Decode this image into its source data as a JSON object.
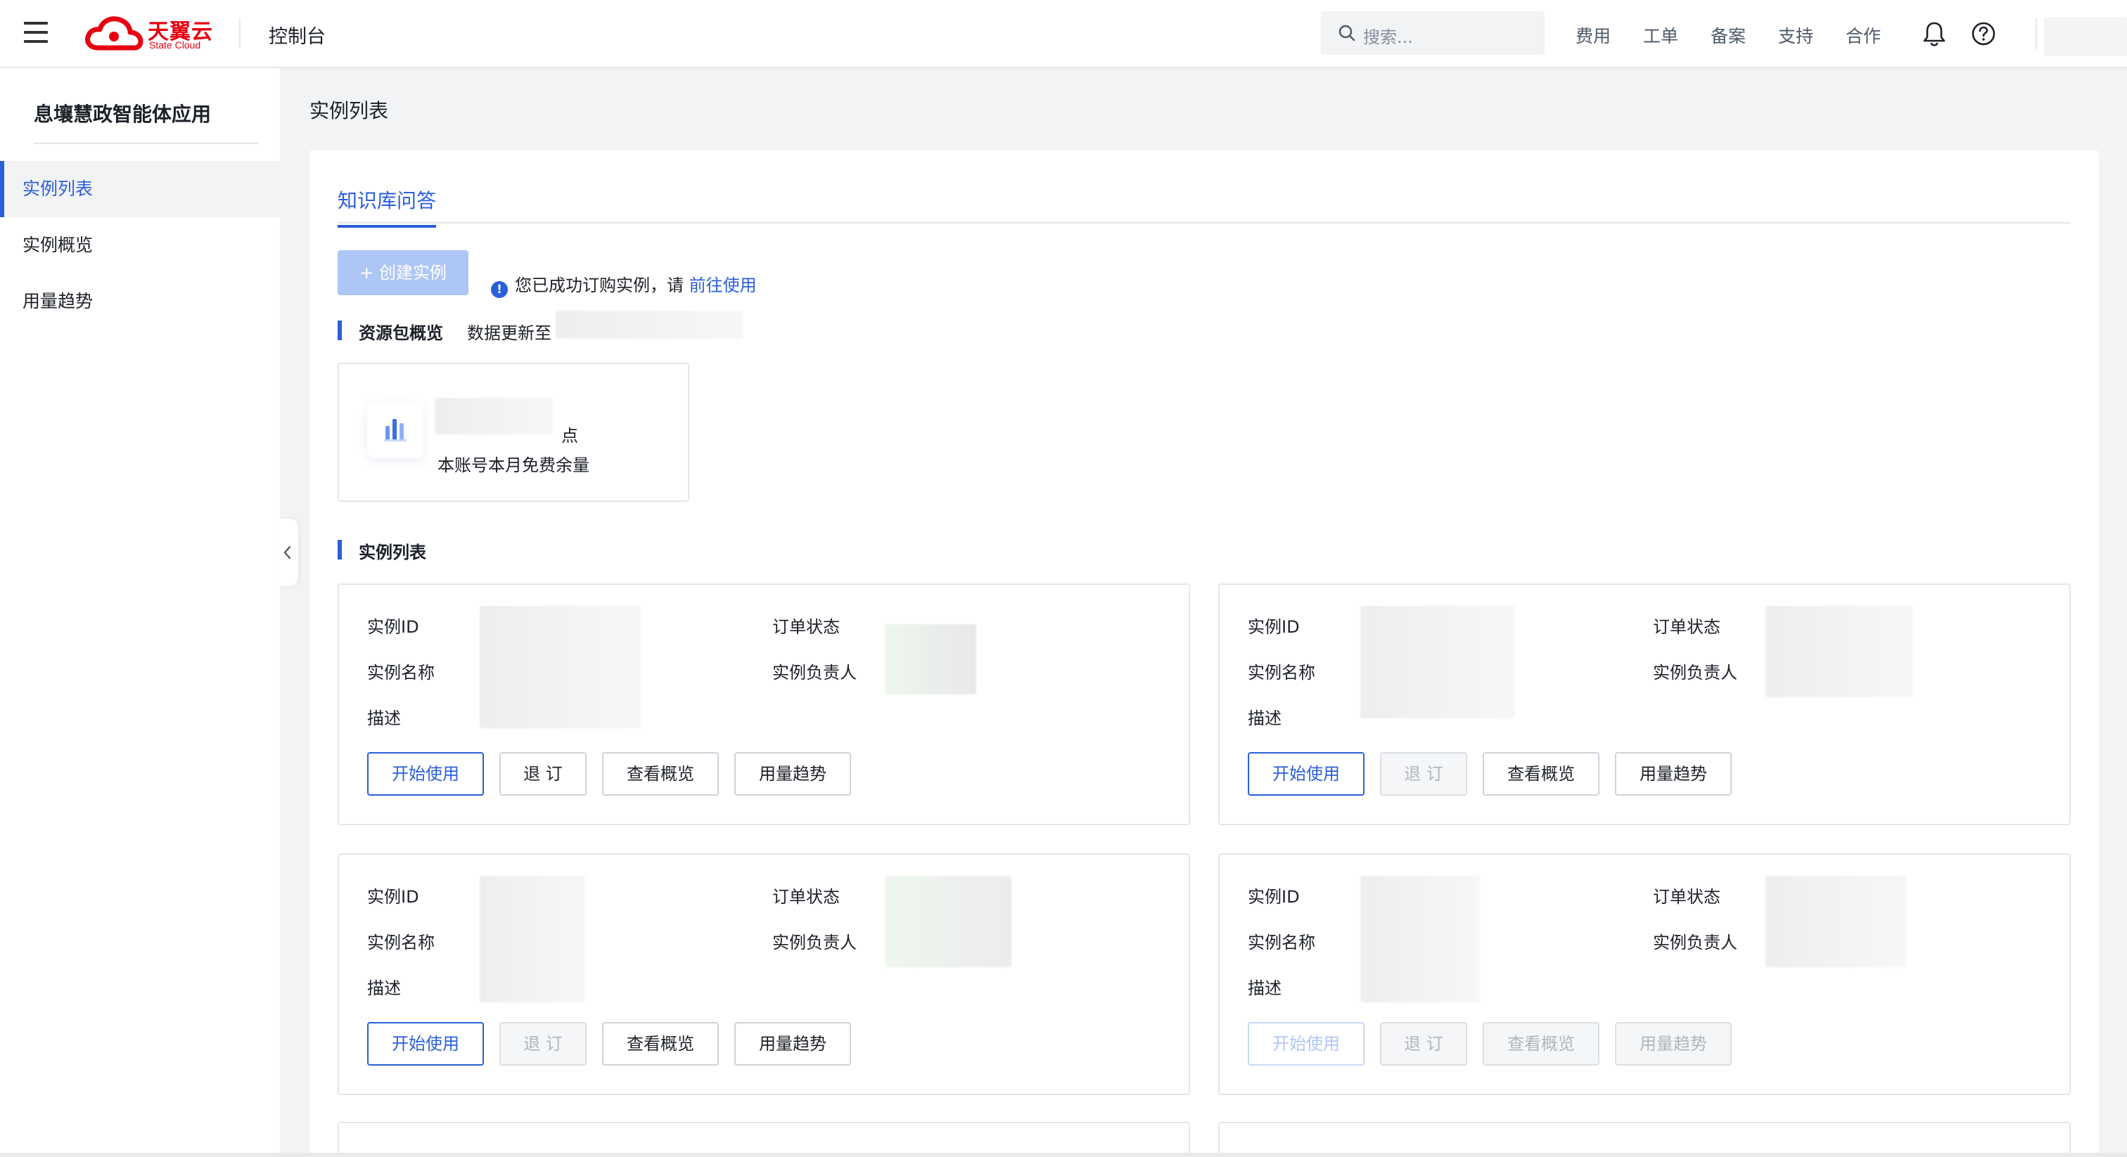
{
  "header": {
    "logo_cn": "天翼云",
    "logo_en": "State Cloud",
    "console": "控制台",
    "search_placeholder": "搜索...",
    "nav": [
      "费用",
      "工单",
      "备案",
      "支持",
      "合作"
    ],
    "icons": [
      "menu-icon",
      "search-icon",
      "bell-icon",
      "help-icon"
    ]
  },
  "sidebar": {
    "title": "息壤慧政智能体应用",
    "items": [
      {
        "label": "实例列表",
        "active": true
      },
      {
        "label": "实例概览",
        "active": false
      },
      {
        "label": "用量趋势",
        "active": false
      }
    ]
  },
  "main": {
    "page_title": "实例列表",
    "tab": "知识库问答",
    "create_button": "+ 创建实例",
    "notice_text": "您已成功订购实例，请",
    "notice_link": "前往使用",
    "resource_section": "资源包概览",
    "update_label": "数据更新至",
    "package": {
      "unit": "点",
      "desc": "本账号本月免费余量"
    },
    "instance_section": "实例列表",
    "field_labels": {
      "id": "实例ID",
      "name": "实例名称",
      "desc": "描述",
      "order_status": "订单状态",
      "owner": "实例负责人"
    },
    "buttons": {
      "start": "开始使用",
      "unsubscribe": "退 订",
      "overview": "查看概览",
      "trend": "用量趋势"
    },
    "instances": [
      {
        "start_enabled": true,
        "unsubscribe_enabled": true,
        "overview_enabled": true,
        "trend_enabled": true
      },
      {
        "start_enabled": true,
        "unsubscribe_enabled": false,
        "overview_enabled": true,
        "trend_enabled": true
      },
      {
        "start_enabled": true,
        "unsubscribe_enabled": false,
        "overview_enabled": true,
        "trend_enabled": true
      },
      {
        "start_enabled": false,
        "unsubscribe_enabled": false,
        "overview_enabled": false,
        "trend_enabled": false
      }
    ]
  },
  "colors": {
    "accent": "#2a5fd9",
    "brand_red": "#e60012",
    "create_disabled": "#aec6f5"
  }
}
